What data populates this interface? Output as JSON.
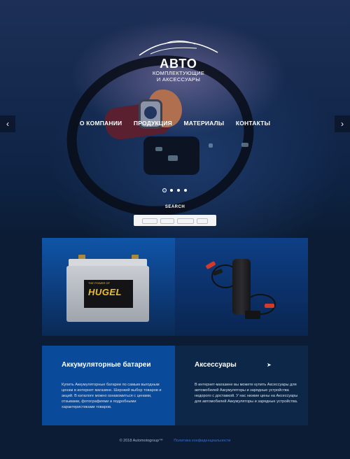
{
  "logo": {
    "main": "АВТО",
    "sub1": "КОМПЛЕКТУЮЩИЕ",
    "sub2": "И АКСЕССУАРЫ"
  },
  "nav": [
    "О КОМПАНИИ",
    "ПРОДУКЦИЯ",
    "МАТЕРИАЛЫ",
    "КОНТАКТЫ"
  ],
  "slider": {
    "prev_icon": "chevron-left-icon",
    "next_icon": "chevron-right-icon",
    "prev": "‹",
    "next": "›",
    "active_dot": 1,
    "dots_total": 4
  },
  "search": {
    "label": "SEARCH",
    "placeholder": ""
  },
  "products": [
    {
      "title": "Аккумуляторные батареи",
      "description": "Купить Аккумуляторные батареи по самым выгодным ценам в интернет магазине. Широкий выбор товаров и акций. В каталоге можно ознакомиться с ценами, отзывами, фотографиями и подробными характеристиками товаров.",
      "image_brand": "HUGEL",
      "image_tagline": "THE POWER OF"
    },
    {
      "title": "Аксессуары",
      "description": "В интернет-магазине вы можете купить Аксессуары для автомобилей Аккумуляторы и зарядные устройства недорого с доставкой. У нас низкие цены на Аксессуары для автомобилей Аккумуляторы и зарядные устройства."
    }
  ],
  "footer": {
    "copyright": "© 2018 Automotogroup™",
    "link": "Политика конфиденциальности"
  },
  "colors": {
    "accent": "#0a4a9a",
    "dark_panel": "#0c2748",
    "page_bg": "#0b1c34",
    "link": "#3d6fc9"
  }
}
